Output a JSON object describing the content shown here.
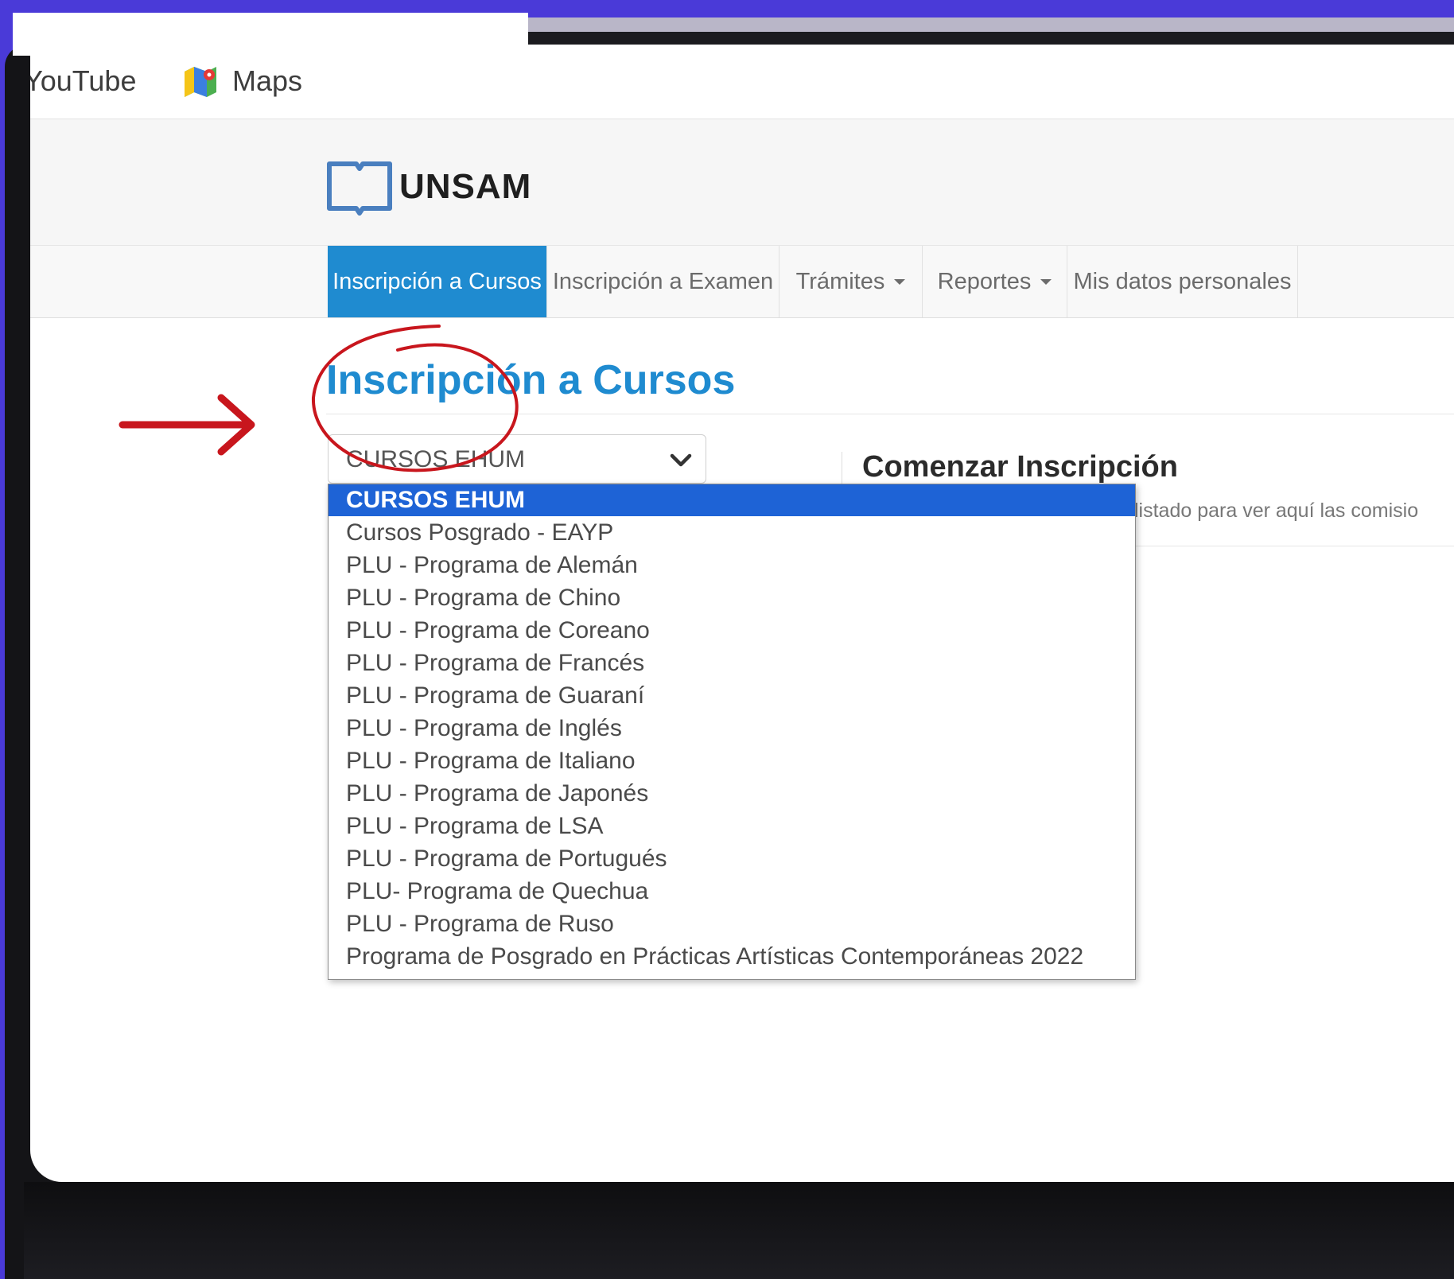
{
  "bookmarks": [
    {
      "label": "YouTube",
      "icon": "youtube-icon"
    },
    {
      "label": "Maps",
      "icon": "maps-icon"
    }
  ],
  "site": {
    "logo_text": "UNSAM",
    "logo_icon": "book-icon"
  },
  "nav": {
    "items": [
      {
        "label": "Inscripción a Cursos",
        "active": true
      },
      {
        "label": "Inscripción a Examen",
        "active": false
      },
      {
        "label": "Trámites",
        "has_caret": true
      },
      {
        "label": "Reportes",
        "has_caret": true
      },
      {
        "label": "Mis datos personales",
        "active": false
      }
    ]
  },
  "page": {
    "title": "Inscripción a Cursos"
  },
  "select": {
    "value": "CURSOS EHUM",
    "options": [
      "CURSOS EHUM",
      "Cursos Posgrado - EAYP",
      "PLU - Programa de Alemán",
      "PLU - Programa de Chino",
      "PLU - Programa de Coreano",
      "PLU - Programa de Francés",
      "PLU - Programa de Guaraní",
      "PLU - Programa de Inglés",
      "PLU - Programa de Italiano",
      "PLU - Programa de Japonés",
      "PLU - Programa de LSA",
      "PLU - Programa de Portugués",
      "PLU- Programa de Quechua",
      "PLU - Programa de Ruso",
      "Programa de Posgrado en Prácticas Artísticas Contemporáneas 2022"
    ],
    "selected_index": 0
  },
  "panel": {
    "title": "Comenzar Inscripción",
    "text": "listado para ver aquí las comisio"
  },
  "colors": {
    "accent": "#1f8bd0",
    "selected_option": "#1e63d6",
    "annotation": "#c8161d",
    "frame": "#4a3ad8"
  },
  "annotations": {
    "arrow": "red-arrow-icon",
    "circle": "red-circle-mark"
  }
}
